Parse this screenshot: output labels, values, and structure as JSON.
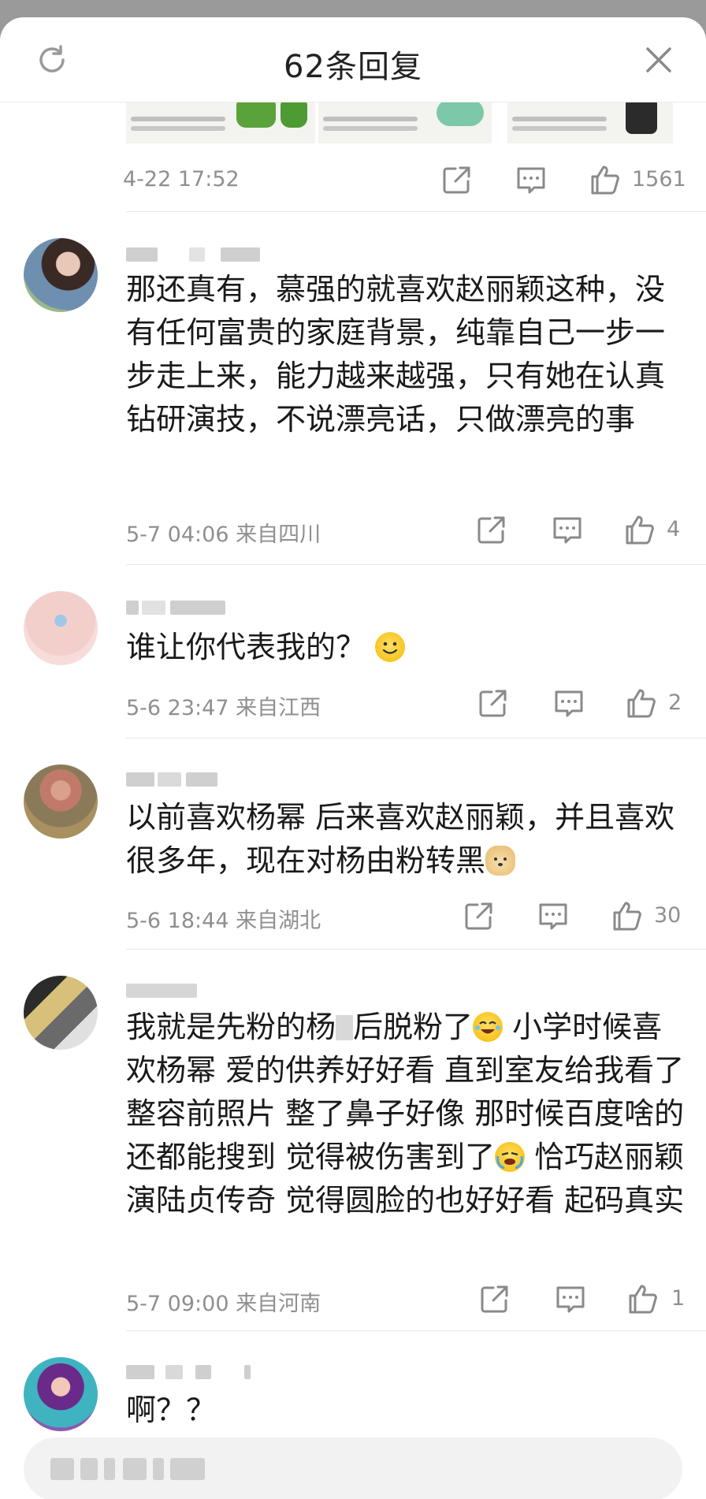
{
  "header": {
    "title": "62条回复"
  },
  "previous": {
    "time": "4-22 17:52",
    "likes": "1561"
  },
  "comments": [
    {
      "body": "那还真有，慕强的就喜欢赵丽颖这种，没有任何富贵的家庭背景，纯靠自己一步一步走上来，能力越来越强，只有她在认真钻研演技，不说漂亮话，只做漂亮的事",
      "time": "5-7 04:06",
      "location": "来自四川",
      "likes": "4"
    },
    {
      "body": "谁让你代表我的？",
      "time": "5-6 23:47",
      "location": "来自江西",
      "likes": "2"
    },
    {
      "body": "以前喜欢杨幂 后来喜欢赵丽颖，并且喜欢很多年，现在对杨由粉转黑",
      "time": "5-6 18:44",
      "location": "来自湖北",
      "likes": "30"
    },
    {
      "body_1": "我就是先粉的杨",
      "body_2": "后脱粉了",
      "body_3": " 小学时候喜欢杨幂 爱的供养好好看 直到室友给我看了整容前照片 整了鼻子好像 那时候百度啥的 还都能搜到 觉得被伤害到了",
      "body_4": " 恰巧赵丽颖演陆贞传奇 觉得圆脸的也好好看 起码真实",
      "time": "5-7 09:00",
      "location": "来自河南",
      "likes": "1"
    },
    {
      "body": "啊？？"
    }
  ],
  "icons": [
    "refresh-icon",
    "close-icon",
    "share-icon",
    "comment-icon",
    "like-icon"
  ],
  "colors": {
    "meta": "#8f8f8f",
    "icon": "#8a8a8a",
    "divider": "#e8e8e8",
    "background_dim": "#9a9a9a"
  }
}
